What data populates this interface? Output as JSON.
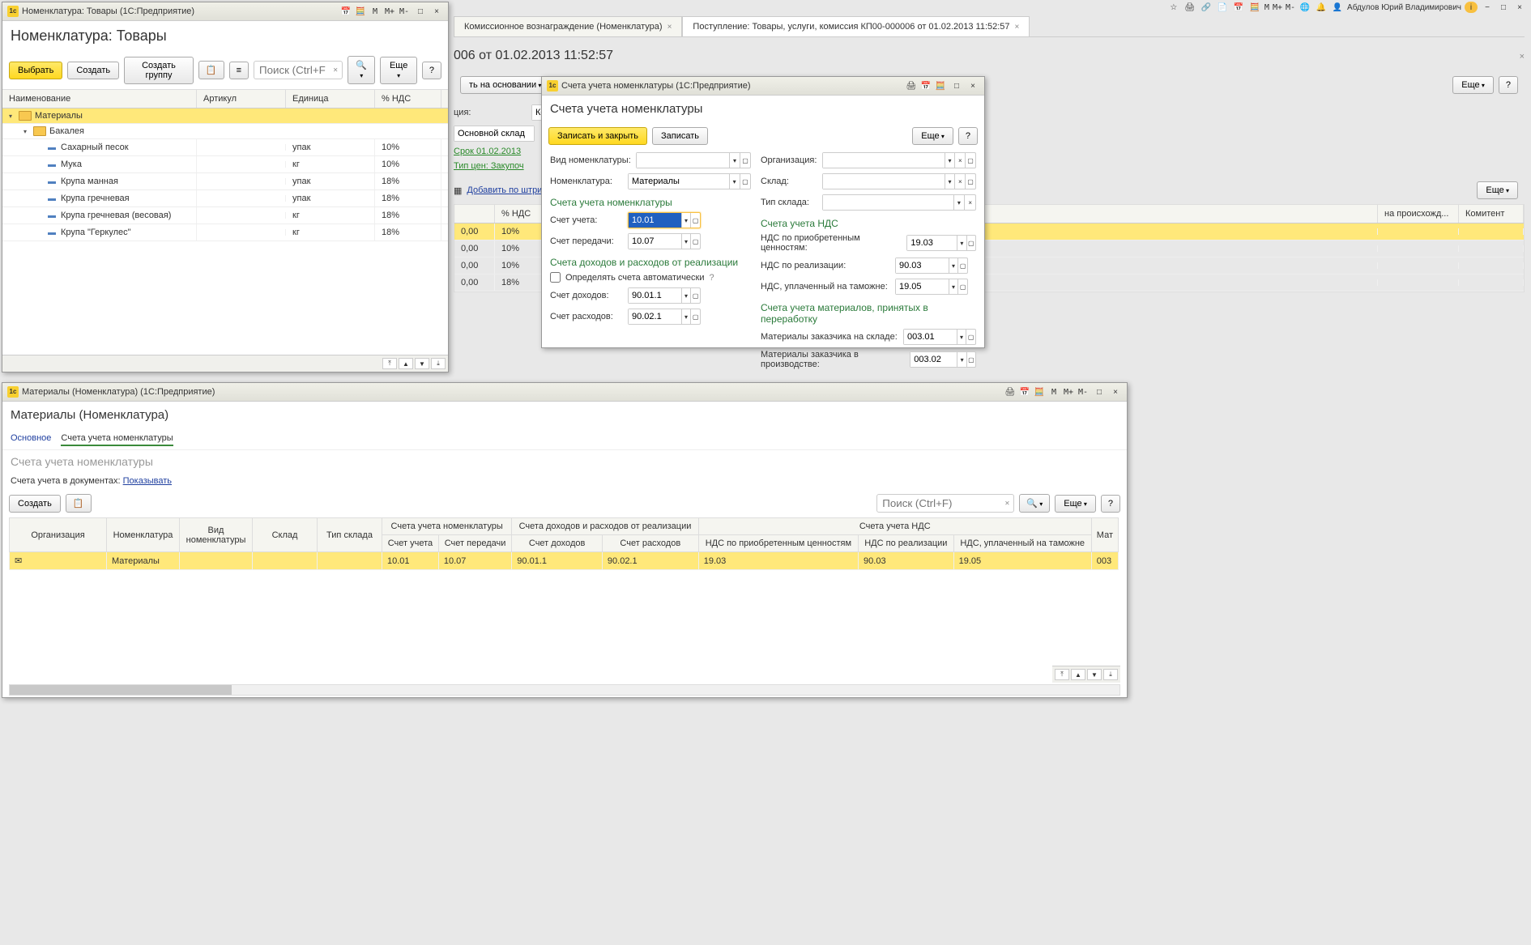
{
  "top_menu": {
    "user": "Абдулов Юрий Владимирович",
    "m_labels": [
      "M",
      "M+",
      "M-"
    ]
  },
  "tabs": [
    {
      "label": "Комиссионное вознаграждение (Номенклатура)"
    },
    {
      "label": "Поступление: Товары, услуги, комиссия КП00-000006 от 01.02.2013 11:52:57"
    }
  ],
  "doc_visible_title": "006 от 01.02.2013 11:52:57",
  "win1": {
    "title": "Номенклатура: Товары  (1С:Предприятие)",
    "page_title": "Номенклатура: Товары",
    "btn_select": "Выбрать",
    "btn_create": "Создать",
    "btn_create_group": "Создать группу",
    "search_placeholder": "Поиск (Ctrl+F)",
    "btn_more": "Еще",
    "cols": {
      "name": "Наименование",
      "art": "Артикул",
      "unit": "Единица",
      "vat": "% НДС"
    },
    "tree": {
      "root": "Материалы",
      "child": "Бакалея",
      "items": [
        {
          "name": "Сахарный песок",
          "unit": "упак",
          "vat": "10%"
        },
        {
          "name": "Мука",
          "unit": "кг",
          "vat": "10%"
        },
        {
          "name": "Крупа манная",
          "unit": "упак",
          "vat": "18%"
        },
        {
          "name": "Крупа гречневая",
          "unit": "упак",
          "vat": "18%"
        },
        {
          "name": "Крупа гречневая (весовая)",
          "unit": "кг",
          "vat": "18%"
        },
        {
          "name": "Крупа \"Геркулес\"",
          "unit": "кг",
          "vat": "18%"
        }
      ]
    },
    "m_labels": [
      "M",
      "M+",
      "M-"
    ]
  },
  "doc_panel": {
    "btn_basis": "ть на основании",
    "btn_barcode": "Добавить по штрихко",
    "org_label": "ция:",
    "org_value": "Конфетпром",
    "warehouse_value": "Основной склад",
    "link_term": "Срок 01.02.2013",
    "link_price_type": "Тип цен: Закупоч",
    "btn_more": "Еще",
    "grid_cols": {
      "vat": "% НДС",
      "origin": "на происхожд...",
      "komitent": "Комитент"
    },
    "rows": [
      {
        "amt": "0,00",
        "vat": "10%"
      },
      {
        "amt": "0,00",
        "vat": "10%"
      },
      {
        "amt": "0,00",
        "vat": "10%"
      },
      {
        "amt": "0,00",
        "vat": "18%"
      }
    ]
  },
  "win2": {
    "title": "Счета учета номенклатуры  (1С:Предприятие)",
    "page_title": "Счета учета номенклатуры",
    "btn_save_close": "Записать и закрыть",
    "btn_save": "Записать",
    "btn_more": "Еще",
    "labels": {
      "kind": "Вид номенклатуры:",
      "nomen": "Номенклатура:",
      "org": "Организация:",
      "warehouse": "Склад:",
      "warehouse_type": "Тип склада:"
    },
    "nomen_value": "Материалы",
    "section1": "Счета учета номенклатуры",
    "account_label": "Счет учета:",
    "account_value": "10.01",
    "transfer_label": "Счет передачи:",
    "transfer_value": "10.07",
    "section2": "Счета доходов и расходов от реализации",
    "auto_label": "Определять счета автоматически",
    "income_label": "Счет доходов:",
    "income_value": "90.01.1",
    "expense_label": "Счет расходов:",
    "expense_value": "90.02.1",
    "section3": "Счета учета НДС",
    "vat_in_label": "НДС по приобретенным ценностям:",
    "vat_in_value": "19.03",
    "vat_out_label": "НДС по реализации:",
    "vat_out_value": "90.03",
    "vat_customs_label": "НДС, уплаченный на таможне:",
    "vat_customs_value": "19.05",
    "section4": "Счета учета материалов, принятых в переработку",
    "mat_stock_label": "Материалы заказчика на складе:",
    "mat_stock_value": "003.01",
    "mat_prod_label": "Материалы заказчика в производстве:",
    "mat_prod_value": "003.02"
  },
  "win3": {
    "title": "Материалы (Номенклатура)  (1С:Предприятие)",
    "page_title": "Материалы (Номенклатура)",
    "tab_main": "Основное",
    "tab_accounts": "Счета учета номенклатуры",
    "subtitle": "Счета учета номенклатуры",
    "docs_label": "Счета учета в документах:",
    "docs_link": "Показывать",
    "btn_create": "Создать",
    "btn_more": "Еще",
    "search_placeholder": "Поиск (Ctrl+F)",
    "cols": {
      "org": "Организация",
      "nomen": "Номенклатура",
      "kind": "Вид номенклатуры",
      "warehouse": "Склад",
      "wtype": "Тип склада",
      "grp1": "Счета учета номенклатуры",
      "g1a": "Счет учета",
      "g1b": "Счет передачи",
      "grp2": "Счета доходов и расходов от реализации",
      "g2a": "Счет доходов",
      "g2b": "Счет расходов",
      "grp3": "Счета учета НДС",
      "g3a": "НДС по приобретенным ценностям",
      "g3b": "НДС по реализации",
      "g3c": "НДС, уплаченный на таможне",
      "grp4": "Мат"
    },
    "row": {
      "nomen": "Материалы",
      "acc": "10.01",
      "transfer": "10.07",
      "income": "90.01.1",
      "expense": "90.02.1",
      "vat_in": "19.03",
      "vat_out": "90.03",
      "vat_customs": "19.05",
      "mat": "003"
    },
    "m_labels": [
      "M",
      "M+",
      "M-"
    ]
  },
  "close_x": "×"
}
